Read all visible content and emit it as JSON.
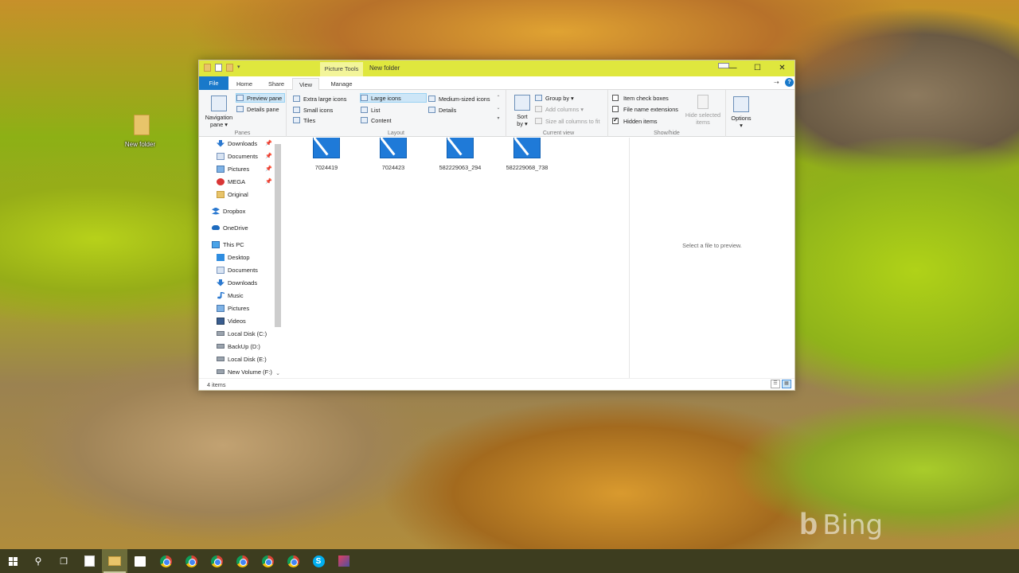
{
  "desktop": {
    "icon_label": "New folder",
    "watermark": "Bing"
  },
  "window": {
    "title": "New folder",
    "context_tab": "Picture Tools",
    "controls": {
      "minimize": "—",
      "maximize": "☐",
      "close": "✕"
    }
  },
  "tabs": [
    {
      "label": "File"
    },
    {
      "label": "Home"
    },
    {
      "label": "Share"
    },
    {
      "label": "View"
    },
    {
      "label": "Manage"
    }
  ],
  "ribbon": {
    "panes": {
      "label": "Panes",
      "navigation_pane": "Navigation pane",
      "navigation_pane_l1": "Navigation",
      "navigation_pane_l2": "pane ▾",
      "preview_pane": "Preview pane",
      "details_pane": "Details pane"
    },
    "layout": {
      "label": "Layout",
      "extra_large_icons": "Extra large icons",
      "large_icons": "Large icons",
      "medium_icons": "Medium-sized icons",
      "small_icons": "Small icons",
      "list": "List",
      "details": "Details",
      "tiles": "Tiles",
      "content": "Content"
    },
    "current_view": {
      "label": "Current view",
      "sort_by_l1": "Sort",
      "sort_by_l2": "by ▾",
      "group_by": "Group by ▾",
      "add_columns": "Add columns ▾",
      "size_columns": "Size all columns to fit"
    },
    "show_hide": {
      "label": "Show/hide",
      "item_check_boxes": "Item check boxes",
      "item_check_boxes_checked": false,
      "file_name_extensions": "File name extensions",
      "file_name_extensions_checked": false,
      "hidden_items": "Hidden items",
      "hidden_items_checked": true,
      "hide_selected_l1": "Hide selected",
      "hide_selected_l2": "items",
      "options_l1": "Options",
      "options_l2": "▾"
    }
  },
  "nav": {
    "quick_access": [
      {
        "label": "Downloads",
        "icon": "download-icon",
        "pinned": true
      },
      {
        "label": "Documents",
        "icon": "document-icon",
        "pinned": true
      },
      {
        "label": "Pictures",
        "icon": "pictures-icon",
        "pinned": true
      },
      {
        "label": "MEGA",
        "icon": "mega-icon",
        "pinned": true
      },
      {
        "label": "Original",
        "icon": "folder-icon",
        "pinned": false
      }
    ],
    "dropbox": "Dropbox",
    "onedrive": "OneDrive",
    "this_pc": "This PC",
    "this_pc_items": [
      {
        "label": "Desktop",
        "icon": "desktop-icon"
      },
      {
        "label": "Documents",
        "icon": "document-icon"
      },
      {
        "label": "Downloads",
        "icon": "download-icon"
      },
      {
        "label": "Music",
        "icon": "music-icon"
      },
      {
        "label": "Pictures",
        "icon": "pictures-icon"
      },
      {
        "label": "Videos",
        "icon": "videos-icon"
      },
      {
        "label": "Local Disk (C:)",
        "icon": "disk-icon"
      },
      {
        "label": "BackUp (D:)",
        "icon": "disk-icon"
      },
      {
        "label": "Local Disk (E:)",
        "icon": "disk-icon"
      },
      {
        "label": "New Volume (F:)",
        "icon": "disk-icon"
      }
    ]
  },
  "files": [
    {
      "name": "7024419"
    },
    {
      "name": "7024423"
    },
    {
      "name": "582229063_294"
    },
    {
      "name": "582229068_738"
    }
  ],
  "preview": {
    "message": "Select a file to preview."
  },
  "status": {
    "item_count": "4 items"
  },
  "colors": {
    "titlebar": "#dfe73e",
    "file_tab": "#1979ca",
    "selection": "#cde6f7",
    "taskbar": "#3d3d1f"
  }
}
